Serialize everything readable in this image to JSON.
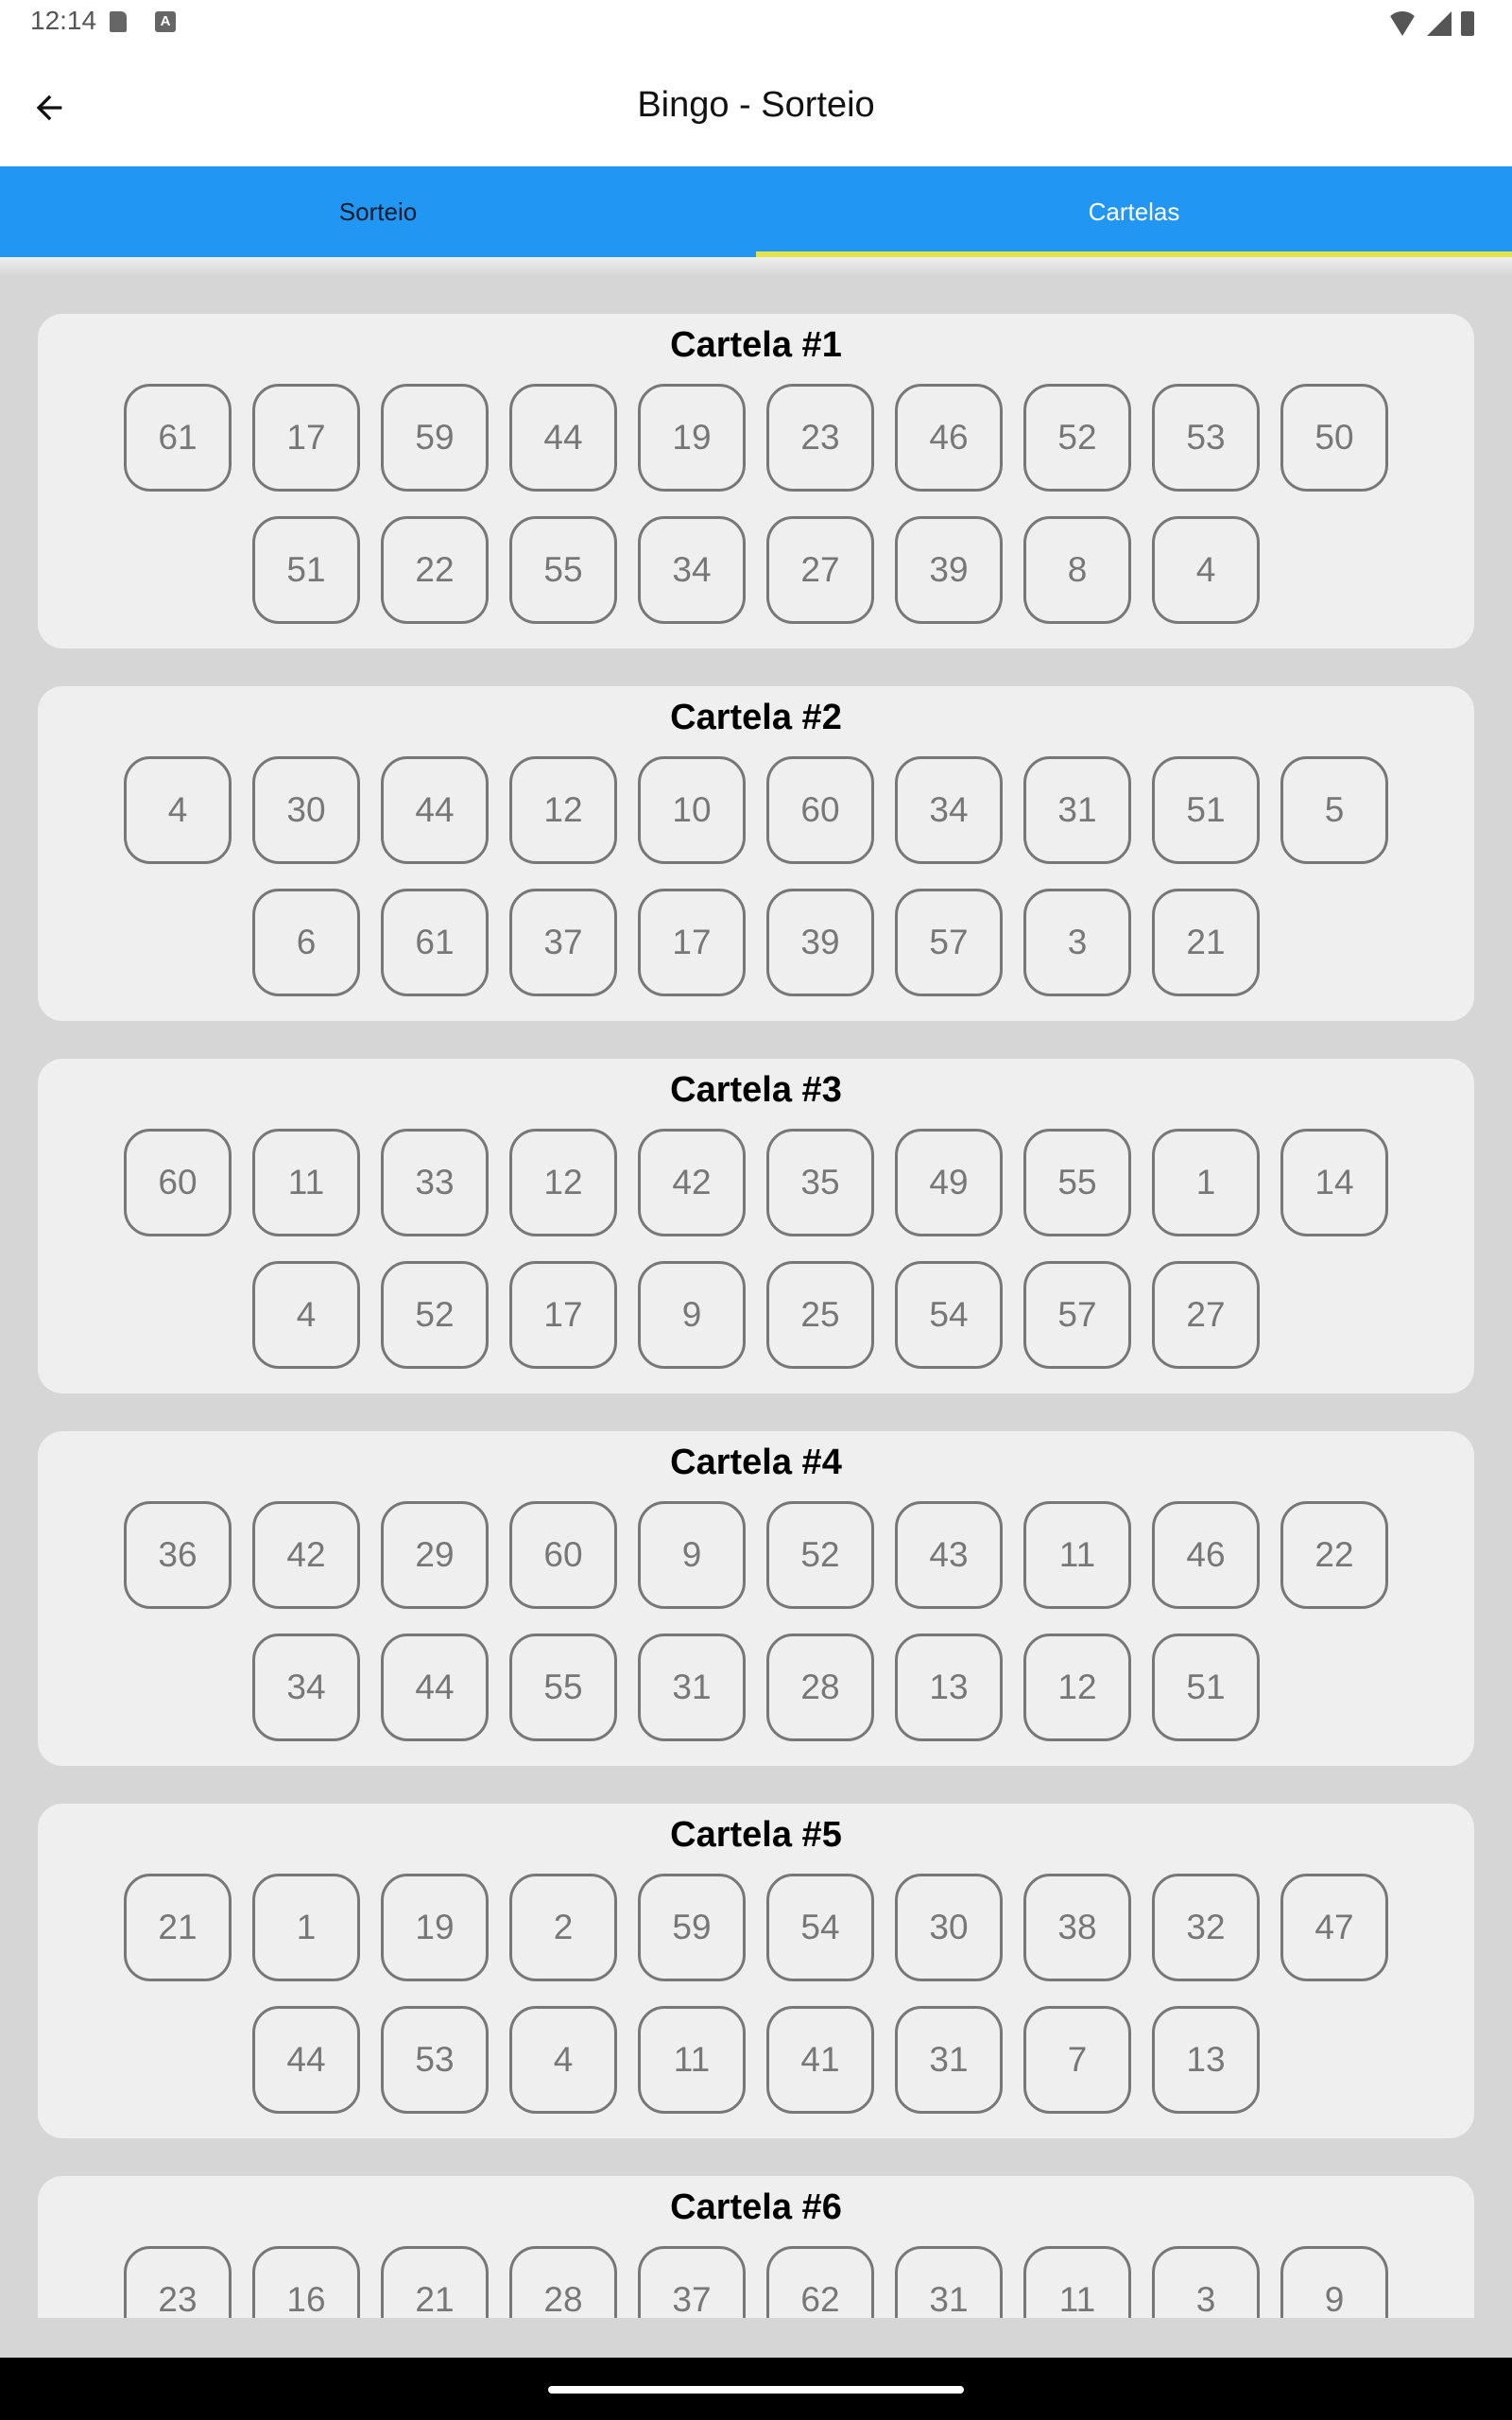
{
  "status": {
    "time": "12:14"
  },
  "app_bar": {
    "title": "Bingo - Sorteio"
  },
  "tabs": [
    {
      "label": "Sorteio",
      "active": false
    },
    {
      "label": "Cartelas",
      "active": true
    }
  ],
  "cards": [
    {
      "title": "Cartela #1",
      "row1": [
        "61",
        "17",
        "59",
        "44",
        "19",
        "23",
        "46",
        "52",
        "53",
        "50"
      ],
      "row2": [
        "51",
        "22",
        "55",
        "34",
        "27",
        "39",
        "8",
        "4"
      ]
    },
    {
      "title": "Cartela #2",
      "row1": [
        "4",
        "30",
        "44",
        "12",
        "10",
        "60",
        "34",
        "31",
        "51",
        "5"
      ],
      "row2": [
        "6",
        "61",
        "37",
        "17",
        "39",
        "57",
        "3",
        "21"
      ]
    },
    {
      "title": "Cartela #3",
      "row1": [
        "60",
        "11",
        "33",
        "12",
        "42",
        "35",
        "49",
        "55",
        "1",
        "14"
      ],
      "row2": [
        "4",
        "52",
        "17",
        "9",
        "25",
        "54",
        "57",
        "27"
      ]
    },
    {
      "title": "Cartela #4",
      "row1": [
        "36",
        "42",
        "29",
        "60",
        "9",
        "52",
        "43",
        "11",
        "46",
        "22"
      ],
      "row2": [
        "34",
        "44",
        "55",
        "31",
        "28",
        "13",
        "12",
        "51"
      ]
    },
    {
      "title": "Cartela #5",
      "row1": [
        "21",
        "1",
        "19",
        "2",
        "59",
        "54",
        "30",
        "38",
        "32",
        "47"
      ],
      "row2": [
        "44",
        "53",
        "4",
        "11",
        "41",
        "31",
        "7",
        "13"
      ]
    },
    {
      "title": "Cartela #6",
      "row1": [
        "23",
        "16",
        "21",
        "28",
        "37",
        "62",
        "31",
        "11",
        "3",
        "9"
      ],
      "row2": []
    }
  ],
  "colors": {
    "tab_bar": "#2196f3",
    "tab_indicator": "#e4e34a",
    "card_bg": "#efefef",
    "page_bg": "#d6d6d6"
  }
}
